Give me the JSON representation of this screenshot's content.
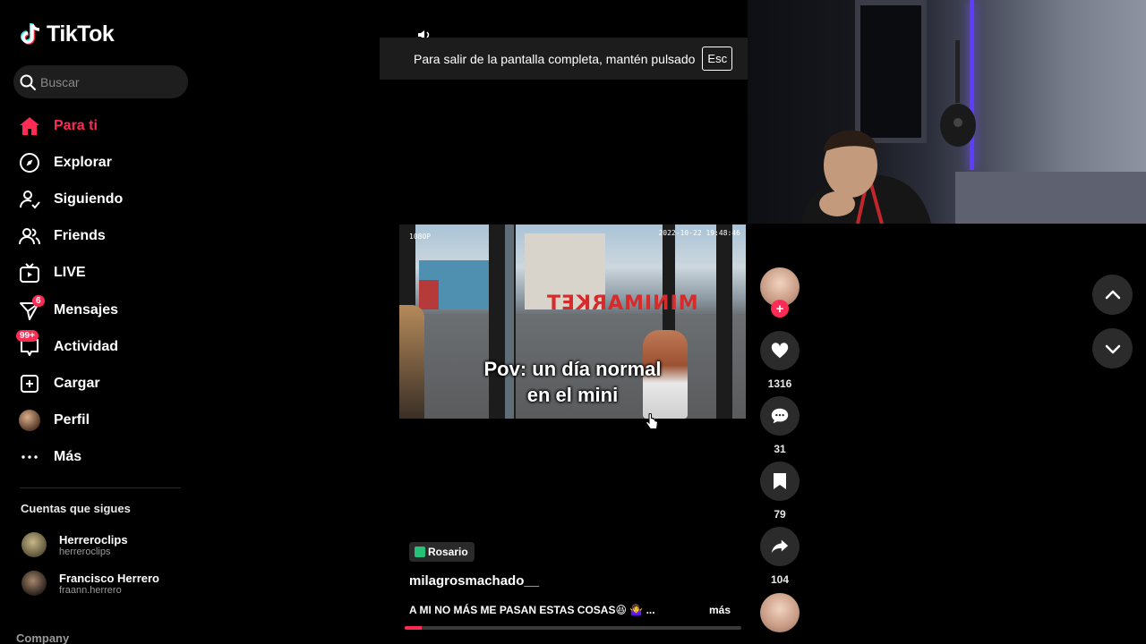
{
  "app": {
    "name": "TikTok"
  },
  "search": {
    "placeholder": "Buscar"
  },
  "nav": {
    "items": [
      {
        "label": "Para ti",
        "icon": "home-icon",
        "active": true
      },
      {
        "label": "Explorar",
        "icon": "compass-icon"
      },
      {
        "label": "Siguiendo",
        "icon": "user-follow-icon"
      },
      {
        "label": "Friends",
        "icon": "friends-icon"
      },
      {
        "label": "LIVE",
        "icon": "live-tv-icon"
      },
      {
        "label": "Mensajes",
        "icon": "paper-plane-icon",
        "badge": "6"
      },
      {
        "label": "Actividad",
        "icon": "activity-icon",
        "badge": "99+"
      },
      {
        "label": "Cargar",
        "icon": "upload-plus-icon"
      },
      {
        "label": "Perfil",
        "icon": "profile-avatar"
      },
      {
        "label": "Más",
        "icon": "more-dots-icon"
      }
    ]
  },
  "following": {
    "title": "Cuentas que sigues",
    "accounts": [
      {
        "name": "Herreroclips",
        "handle": "herreroclips"
      },
      {
        "name": "Francisco Herrero",
        "handle": "fraann.herrero"
      }
    ]
  },
  "footer": {
    "company": "Company"
  },
  "fullscreen_banner": {
    "text": "Para salir de la pantalla completa, mantén pulsado",
    "key": "Esc"
  },
  "video": {
    "caption_line1": "Pov: un día normal",
    "caption_line2": "en el mini",
    "sign_text": "MINIMARKET",
    "hud_left": "1080P",
    "hud_right": "2022-10-22 19:48:46",
    "location": "Rosario",
    "author": "milagrosmachado__",
    "description": "A MI NO MÁS ME PASAN ESTAS COSAS😆 🤷‍♀️ ...",
    "more_label": "más",
    "progress_percent": 5
  },
  "actions": {
    "likes": "1316",
    "comments": "31",
    "saves": "79",
    "shares": "104"
  },
  "colors": {
    "accent": "#fe2c55",
    "background": "#000000",
    "button_bg": "#2b2b2b"
  }
}
